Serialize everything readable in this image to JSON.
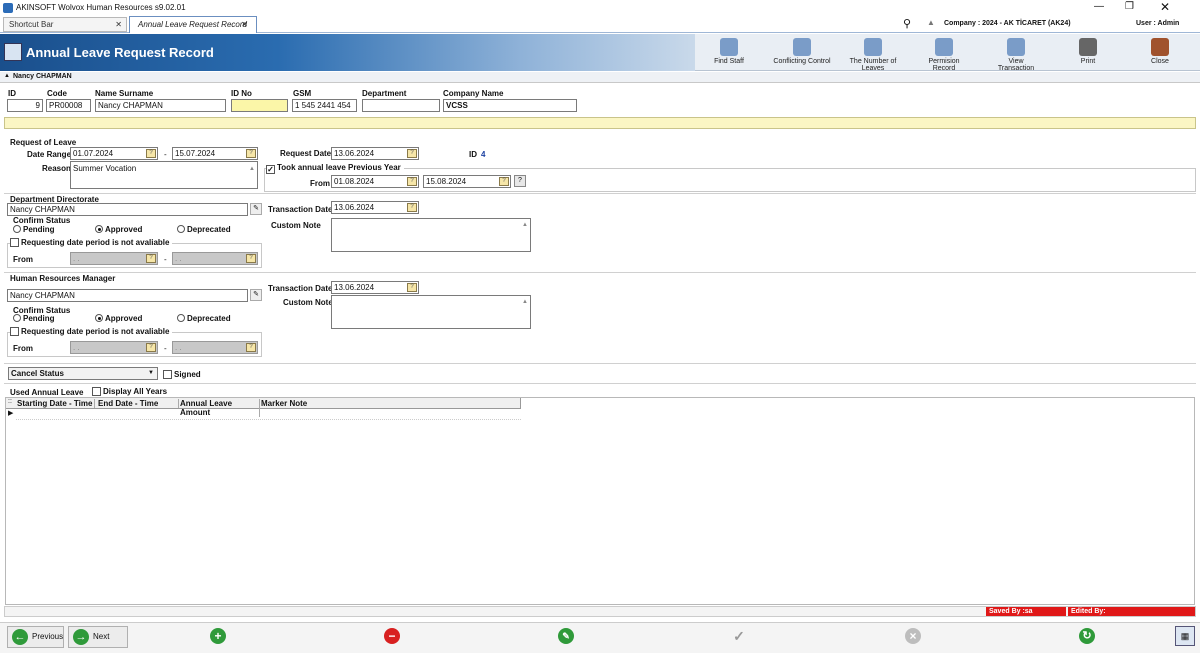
{
  "window": {
    "title": "AKINSOFT Wolvox Human Resources s9.02.01"
  },
  "tabs": [
    {
      "label": "Shortcut Bar"
    },
    {
      "label": "Annual Leave Request Record"
    }
  ],
  "topbar": {
    "company": "Company : 2024 - AK TİCARET (AK24)",
    "user": "User : Admin"
  },
  "header": {
    "title": "Annual Leave Request Record"
  },
  "toolbar": [
    {
      "label": "Find Staff",
      "icon": "find-staff-icon"
    },
    {
      "label": "Conflicting Control",
      "icon": "conflicting-control-icon"
    },
    {
      "label": "The Number of Leaves",
      "icon": "number-of-leaves-icon"
    },
    {
      "label": "Permision Record",
      "icon": "permission-record-icon"
    },
    {
      "label": "View Transaction",
      "icon": "view-transaction-icon"
    },
    {
      "label": "Print",
      "icon": "printer-icon"
    },
    {
      "label": "Close",
      "icon": "door-close-icon"
    }
  ],
  "staff_bar": {
    "name": "Nancy CHAPMAN"
  },
  "staff": {
    "labels": {
      "id": "ID",
      "code": "Code",
      "name": "Name Surname",
      "idno": "ID No",
      "gsm": "GSM",
      "dept": "Department",
      "company": "Company Name"
    },
    "values": {
      "id": "9",
      "code": "PR00008",
      "name": "Nancy CHAPMAN",
      "idno": "",
      "gsm": "1 545 2441 454",
      "dept": "",
      "company": "VCSS"
    }
  },
  "request": {
    "section": "Request of Leave",
    "date_range_label": "Date Range",
    "date_from": "01.07.2024",
    "dash": "-",
    "date_to": "15.07.2024",
    "reason_label": "Reason",
    "reason": "Summer Vocation",
    "request_date_label": "Request Date",
    "request_date": "13.06.2024",
    "id_label": "ID",
    "id_value": "4",
    "prev_year_label": "Took annual leave Previous Year",
    "prev_from_label": "From",
    "prev_from": "01.08.2024",
    "prev_to": "15.08.2024"
  },
  "dept_dir": {
    "section": "Department Directorate",
    "person": "Nancy CHAPMAN",
    "confirm_label": "Confirm Status",
    "opt_pending": "Pending",
    "opt_approved": "Approved",
    "opt_deprecated": "Deprecated",
    "selected": "Approved",
    "not_available_label": "Requesting date period is not avaliable",
    "from_label": "From",
    "from_ph": ". .",
    "to_ph": ". .",
    "dash": "-",
    "trans_date_label": "Transaction Date",
    "trans_date": "13.06.2024",
    "note_label": "Custom Note",
    "note": ""
  },
  "hr_mgr": {
    "section": "Human Resources Manager",
    "person": "Nancy CHAPMAN",
    "confirm_label": "Confirm Status",
    "opt_pending": "Pending",
    "opt_approved": "Approved",
    "opt_deprecated": "Deprecated",
    "selected": "Approved",
    "not_available_label": "Requesting date period is not avaliable",
    "from_label": "From",
    "from_ph": ". .",
    "to_ph": ". .",
    "dash": "-",
    "trans_date_label": "Transaction Date",
    "trans_date": "13.06.2024",
    "note_label": "Custom Note",
    "note": ""
  },
  "cancel": {
    "select_value": "Cancel Status",
    "signed_label": "Signed"
  },
  "used": {
    "section": "Used Annual Leave",
    "display_all_label": "Display All Years",
    "columns": [
      "Starting Date - Time",
      "End Date - Time",
      "Annual Leave Amount",
      "Marker Note"
    ]
  },
  "status": {
    "saved_by": "Saved By :sa",
    "edited_by": "Edited By:"
  },
  "nav": {
    "previous": "Previous",
    "next": "Next"
  },
  "colors": {
    "header_blue": "#1f5fa0",
    "yellow": "#fbf6c4",
    "status_red": "#e01818",
    "green": "#2f9a3a"
  }
}
